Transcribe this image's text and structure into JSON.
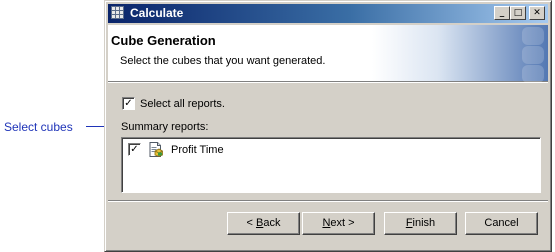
{
  "annotation": {
    "text": "Select cubes"
  },
  "window": {
    "title": "Calculate",
    "controls": {
      "minimize": "_",
      "maximize": "□",
      "close": "✕"
    }
  },
  "header": {
    "title": "Cube Generation",
    "subtitle": "Select the cubes that you want generated."
  },
  "options": {
    "select_all_label": "Select all reports.",
    "select_all_checked": true
  },
  "summary": {
    "label": "Summary reports:",
    "items": [
      {
        "label": "Profit Time",
        "checked": true,
        "icon": "report-document-icon"
      }
    ]
  },
  "buttons": {
    "back": {
      "prefix": "< ",
      "mnemonic": "B",
      "rest": "ack"
    },
    "next": {
      "prefix": "",
      "mnemonic": "N",
      "rest": "ext >"
    },
    "finish": {
      "prefix": "",
      "mnemonic": "F",
      "rest": "inish"
    },
    "cancel": {
      "label": "Cancel"
    }
  },
  "colors": {
    "annotation": "#1f34b8",
    "titlebar_start": "#0a246a",
    "titlebar_end": "#a6caf0",
    "dialog_face": "#d4d0c8"
  }
}
